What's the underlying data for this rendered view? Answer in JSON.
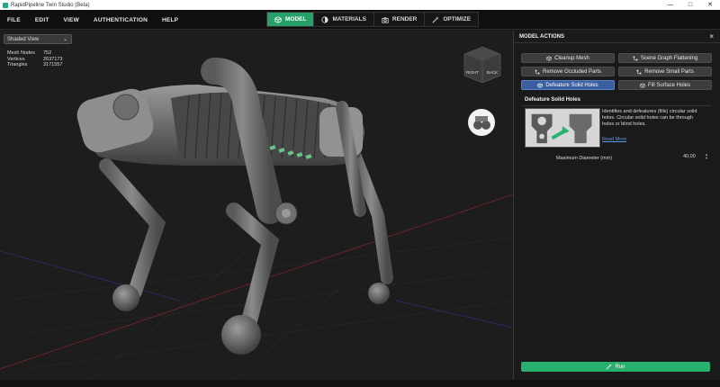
{
  "window": {
    "title": "RapidPipeline Twin Studio (Beta)"
  },
  "menu": [
    "FILE",
    "EDIT",
    "VIEW",
    "AUTHENTICATION",
    "HELP"
  ],
  "modes": [
    {
      "label": "MODEL",
      "icon": "cube-icon",
      "active": true
    },
    {
      "label": "MATERIALS",
      "icon": "palette-icon",
      "active": false
    },
    {
      "label": "RENDER",
      "icon": "camera-icon",
      "active": false
    },
    {
      "label": "OPTIMIZE",
      "icon": "magic-wand-icon",
      "active": false
    }
  ],
  "viewport": {
    "view_mode": "Shaded View",
    "stats": [
      {
        "label": "Mesh Nodes",
        "value": "752"
      },
      {
        "label": "Vertices",
        "value": "2637173"
      },
      {
        "label": "Triangles",
        "value": "3171557"
      }
    ],
    "navcube": {
      "left_face": "RIGHT",
      "right_face": "BACK"
    }
  },
  "panel": {
    "title": "MODEL ACTIONS",
    "actions": [
      {
        "label": "Cleanup Mesh",
        "active": false
      },
      {
        "label": "Scene Graph Flattening",
        "active": false
      },
      {
        "label": "Remove Occluded Parts",
        "active": false
      },
      {
        "label": "Remove Small Parts",
        "active": false
      },
      {
        "label": "Defeature Solid Holes",
        "active": true
      },
      {
        "label": "Fill Surface Holes",
        "active": false
      }
    ],
    "section": {
      "title": "Defeature Solid Holes",
      "description": "Identifies and defeatures (fills) circular solid holes. Circular solid holes can be through holes or blind holes.",
      "read_more": "Read More",
      "param_label": "Maximum Diameter (mm)",
      "param_value": "40,00"
    },
    "run_label": "Run"
  },
  "colors": {
    "accent": "#27a06a",
    "selected": "#3a5ea0",
    "link": "#5b9be8"
  }
}
